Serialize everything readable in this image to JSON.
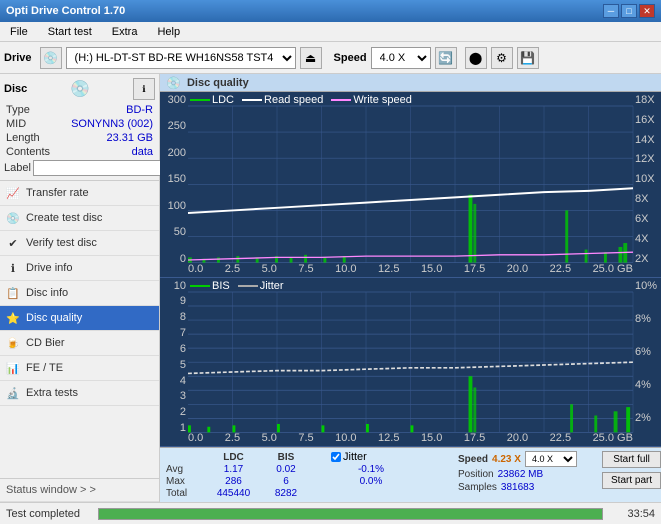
{
  "titlebar": {
    "title": "Opti Drive Control 1.70",
    "minimize": "─",
    "maximize": "□",
    "close": "✕"
  },
  "menubar": {
    "items": [
      "File",
      "Start test",
      "Extra",
      "Help"
    ]
  },
  "toolbar": {
    "drive_label": "Drive",
    "drive_value": "(H:)  HL-DT-ST BD-RE  WH16NS58 TST4",
    "speed_label": "Speed",
    "speed_value": "4.0 X"
  },
  "sidebar": {
    "disc_title": "Disc",
    "disc_type_label": "Type",
    "disc_type_value": "BD-R",
    "disc_mid_label": "MID",
    "disc_mid_value": "SONYNN3 (002)",
    "disc_length_label": "Length",
    "disc_length_value": "23.31 GB",
    "disc_contents_label": "Contents",
    "disc_contents_value": "data",
    "disc_label_label": "Label",
    "disc_label_value": "",
    "nav_items": [
      {
        "id": "transfer-rate",
        "label": "Transfer rate",
        "icon": "📈"
      },
      {
        "id": "create-test-disc",
        "label": "Create test disc",
        "icon": "💿"
      },
      {
        "id": "verify-test-disc",
        "label": "Verify test disc",
        "icon": "✔"
      },
      {
        "id": "drive-info",
        "label": "Drive info",
        "icon": "ℹ"
      },
      {
        "id": "disc-info",
        "label": "Disc info",
        "icon": "📋"
      },
      {
        "id": "disc-quality",
        "label": "Disc quality",
        "icon": "⭐",
        "active": true
      },
      {
        "id": "cd-bier",
        "label": "CD Bier",
        "icon": "🍺"
      },
      {
        "id": "fe-te",
        "label": "FE / TE",
        "icon": "📊"
      },
      {
        "id": "extra-tests",
        "label": "Extra tests",
        "icon": "🔬"
      }
    ],
    "status_window_label": "Status window > >"
  },
  "disc_quality": {
    "title": "Disc quality",
    "legend": {
      "ldc": "LDC",
      "read_speed": "Read speed",
      "write_speed": "Write speed"
    },
    "chart1": {
      "y_max": 300,
      "y_labels_left": [
        "300",
        "250",
        "200",
        "150",
        "100",
        "50",
        "0"
      ],
      "y_labels_right": [
        "18X",
        "16X",
        "14X",
        "12X",
        "10X",
        "8X",
        "6X",
        "4X",
        "2X"
      ],
      "x_labels": [
        "0.0",
        "2.5",
        "5.0",
        "7.5",
        "10.0",
        "12.5",
        "15.0",
        "17.5",
        "20.0",
        "22.5",
        "25.0 GB"
      ]
    },
    "chart2": {
      "legend": {
        "bis": "BIS",
        "jitter": "Jitter"
      },
      "y_labels_left": [
        "10",
        "9",
        "8",
        "7",
        "6",
        "5",
        "4",
        "3",
        "2",
        "1"
      ],
      "y_labels_right": [
        "10%",
        "8%",
        "6%",
        "4%",
        "2%"
      ],
      "x_labels": [
        "0.0",
        "2.5",
        "5.0",
        "7.5",
        "10.0",
        "12.5",
        "15.0",
        "17.5",
        "20.0",
        "22.5",
        "25.0 GB"
      ]
    },
    "stats": {
      "headers": [
        "",
        "LDC",
        "BIS",
        "",
        "Jitter",
        "Speed",
        ""
      ],
      "avg_label": "Avg",
      "avg_ldc": "1.17",
      "avg_bis": "0.02",
      "avg_jitter": "-0.1%",
      "max_label": "Max",
      "max_ldc": "286",
      "max_bis": "6",
      "max_jitter": "0.0%",
      "total_label": "Total",
      "total_ldc": "445440",
      "total_bis": "8282",
      "jitter_label": "Jitter",
      "jitter_checked": true,
      "speed_value": "4.23 X",
      "speed_select": "4.0 X",
      "position_label": "Position",
      "position_value": "23862 MB",
      "samples_label": "Samples",
      "samples_value": "381683",
      "start_full": "Start full",
      "start_part": "Start part"
    }
  },
  "statusbar": {
    "status_text": "Test completed",
    "progress": 100,
    "time": "33:54"
  }
}
